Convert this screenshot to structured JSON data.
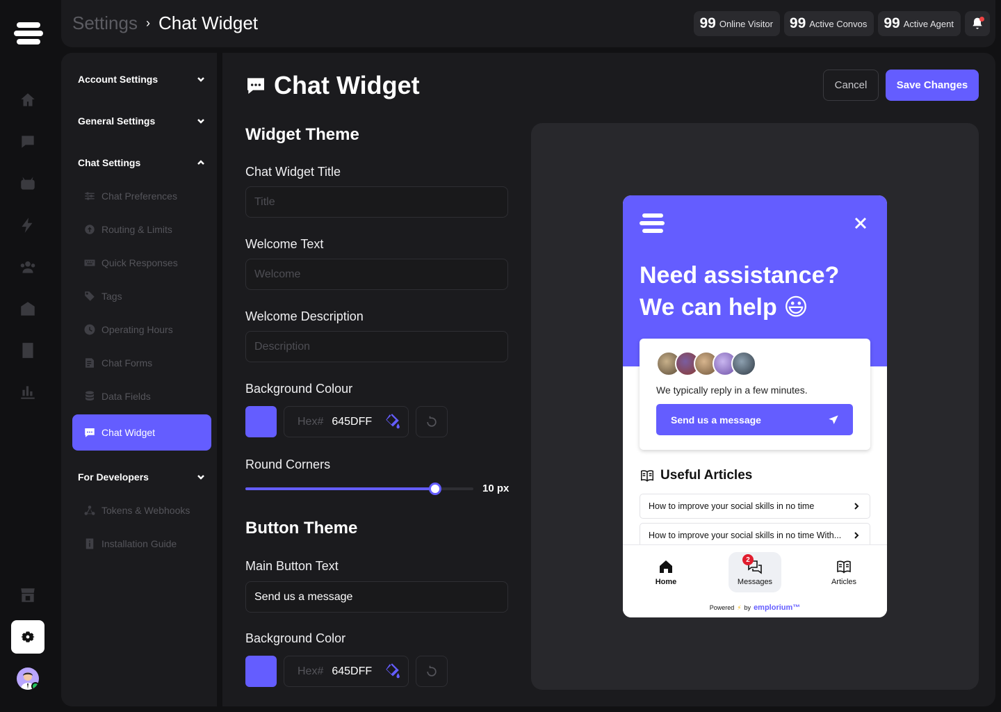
{
  "breadcrumb": {
    "parent": "Settings",
    "separator": "›",
    "current": "Chat Widget"
  },
  "stats": [
    {
      "value": "99",
      "label": "Online Visitor"
    },
    {
      "value": "99",
      "label": "Active Convos"
    },
    {
      "value": "99",
      "label": "Active Agent"
    }
  ],
  "rail": {
    "icons": [
      "home-icon",
      "chat-icon",
      "bot-icon",
      "automation-icon",
      "team-icon",
      "office-icon",
      "document-icon",
      "analytics-icon"
    ],
    "bottom_icons": [
      "store-icon",
      "gear-icon",
      "avatar"
    ]
  },
  "sidenav": {
    "groups": [
      {
        "label": "Account Settings",
        "expanded": false
      },
      {
        "label": "General Settings",
        "expanded": false
      },
      {
        "label": "Chat Settings",
        "expanded": true
      },
      {
        "label": "For Developers",
        "expanded": false
      }
    ],
    "chat_items": [
      "Chat Preferences",
      "Routing & Limits",
      "Quick Responses",
      "Tags",
      "Operating Hours",
      "Chat Forms",
      "Data Fields",
      "Chat Widget"
    ],
    "dev_items": [
      "Tokens & Webhooks",
      "Installation Guide"
    ],
    "active_item": "Chat Widget"
  },
  "page": {
    "title": "Chat Widget",
    "cancel_label": "Cancel",
    "save_label": "Save Changes"
  },
  "form": {
    "widget_theme": "Widget Theme",
    "title_label": "Chat Widget Title",
    "title_placeholder": "Title",
    "welcome_label": "Welcome Text",
    "welcome_placeholder": "Welcome",
    "desc_label": "Welcome Description",
    "desc_placeholder": "Description",
    "bg_label": "Background Colour",
    "hex_prefix": "Hex#",
    "bg_hex": "645DFF",
    "corners_label": "Round Corners",
    "corners_value": 10,
    "corners_max": 12,
    "corners_text": "10 px",
    "button_theme": "Button Theme",
    "main_btn_label": "Main Button Text",
    "main_btn_value": "Send us a message",
    "btn_bg_label": "Background Color",
    "btn_bg_hex": "645DFF"
  },
  "widget": {
    "headline_1": "Need assistance?",
    "headline_2": "We can help",
    "emoji": "😃",
    "reply_text": "We typically reply in a few minutes.",
    "send_label": "Send us a message",
    "articles_title": "Useful Articles",
    "articles": [
      "How to improve your social skills in no time",
      "How to improve your social skills in no time With..."
    ],
    "tabs": [
      {
        "label": "Home",
        "icon": "home-icon"
      },
      {
        "label": "Messages",
        "icon": "messages-icon",
        "badge": "2"
      },
      {
        "label": "Articles",
        "icon": "book-icon"
      }
    ],
    "powered_prefix": "Powered",
    "powered_by": "by",
    "brand": "emplorium™"
  },
  "colors": {
    "accent": "#645DFF",
    "panel": "#1B1B1E",
    "background": "#111113"
  }
}
